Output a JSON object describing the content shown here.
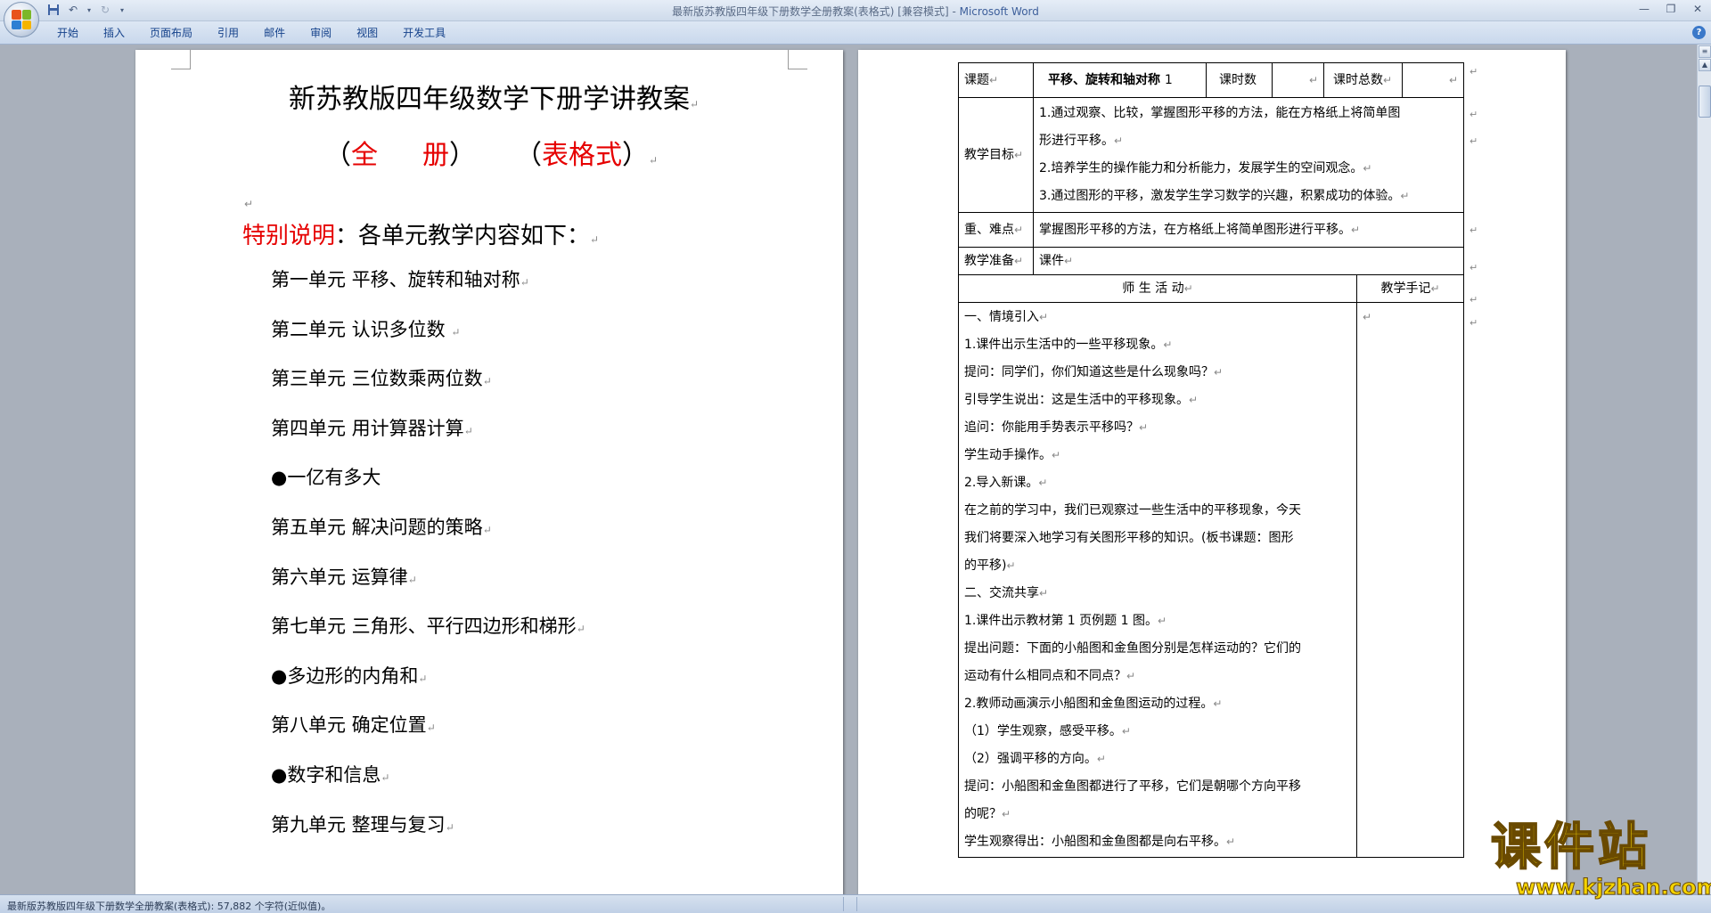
{
  "window": {
    "title_doc": "最新版苏教版四年级下册数学全册教案(表格式) [兼容模式]",
    "title_sep": " - ",
    "title_app": "Microsoft Word"
  },
  "ribbon": {
    "tabs": [
      "开始",
      "插入",
      "页面布局",
      "引用",
      "邮件",
      "审阅",
      "视图",
      "开发工具"
    ]
  },
  "page1": {
    "title": "新苏教版四年级数学下册学讲教案",
    "sub_open1": "（",
    "sub_quan": "全",
    "sub_ce": "册",
    "sub_close1": "）",
    "sub_open2": "（",
    "sub_biao": "表格式",
    "sub_close2": "）",
    "special_label": "特别说明",
    "special_text": "：各单元教学内容如下：",
    "units": [
      "第一单元  平移、旋转和轴对称",
      "第二单元  认识多位数 ",
      "第三单元  三位数乘两位数",
      "第四单元  用计算器计算",
      "●一亿有多大",
      "第五单元  解决问题的策略",
      "第六单元  运算律",
      "第七单元  三角形、平行四边形和梯形",
      "●多边形的内角和",
      "第八单元  确定位置",
      "●数字和信息",
      "第九单元  整理与复习"
    ]
  },
  "page2": {
    "row1": {
      "label": "课题",
      "topic": "平移、旋转和轴对称",
      "topic_num": "1",
      "hours_label": "课时数",
      "total_label": "课时总数"
    },
    "goals_label": "教学目标",
    "goals": [
      "1.通过观察、比较，掌握图形平移的方法，能在方格纸上将简单图",
      "形进行平移。",
      "2.培养学生的操作能力和分析能力，发展学生的空间观念。",
      "3.通过图形的平移，激发学生学习数学的兴趣，积累成功的体验。"
    ],
    "key_label": "重、难点",
    "key_text": "掌握图形平移的方法，在方格纸上将简单图形进行平移。",
    "prep_label": "教学准备",
    "prep_text": "课件",
    "activity_header": "师    生    活    动",
    "notes_header": "教学手记",
    "activity_lines": [
      "一、情境引入",
      "1.课件出示生活中的一些平移现象。",
      "提问：同学们，你们知道这些是什么现象吗？",
      "引导学生说出：这是生活中的平移现象。",
      "追问：你能用手势表示平移吗？",
      "学生动手操作。",
      "2.导入新课。",
      "在之前的学习中，我们已观察过一些生活中的平移现象，今天",
      "我们将要深入地学习有关图形平移的知识。(板书课题：图形",
      "的平移)",
      "二、交流共享",
      "1.课件出示教材第 1 页例题 1 图。",
      "提出问题：下面的小船图和金鱼图分别是怎样运动的？它们的",
      "运动有什么相同点和不同点？",
      "2.教师动画演示小船图和金鱼图运动的过程。",
      "（1）学生观察，感受平移。",
      "（2）强调平移的方向。",
      "提问：小船图和金鱼图都进行了平移，它们是朝哪个方向平移",
      "的呢？",
      "学生观察得出：小船图和金鱼图都是向右平移。"
    ]
  },
  "status": {
    "text": "最新版苏教版四年级下册数学全册教案(表格式): 57,882 个字符(近似值)。"
  },
  "watermark": {
    "main": "课件站",
    "url": "www.kjzhan.com"
  },
  "colors": {
    "accent_red": "#e60000",
    "watermark_yellow": "#f5d400"
  }
}
